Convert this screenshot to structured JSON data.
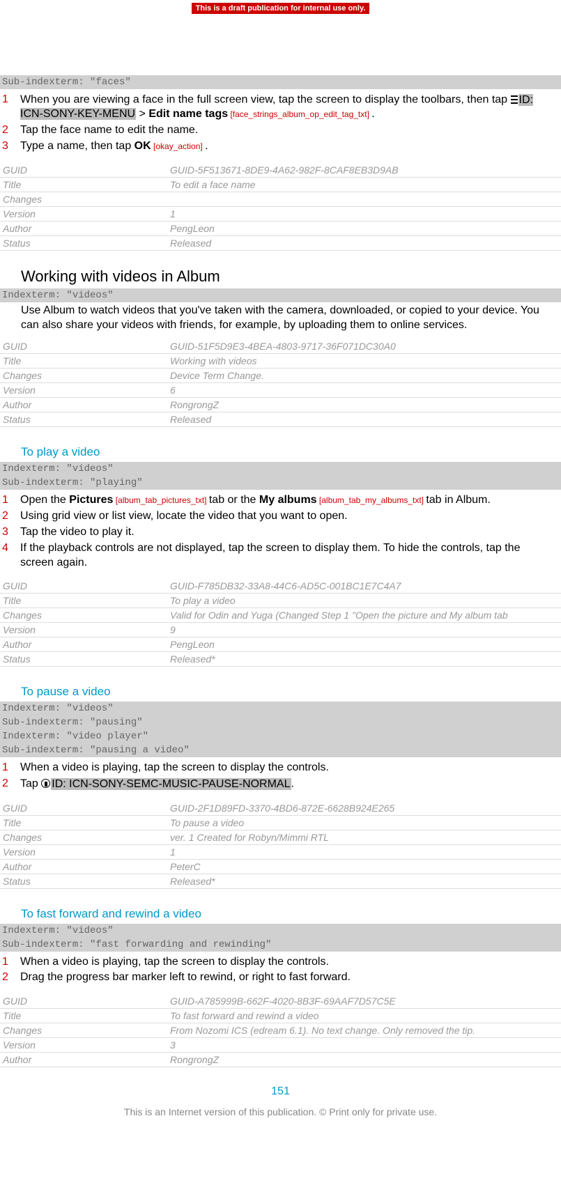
{
  "banner": "This is a draft publication for internal use only.",
  "block1": {
    "subindex": "Sub-indexterm: \"faces\"",
    "steps": [
      {
        "n": "1",
        "pre": "When you are viewing a face in the full screen view, tap the screen to display the toolbars, then tap ",
        "icnid": "ID: ICN-SONY-KEY-MENU",
        "mid": " > ",
        "bold": "Edit name tags",
        "sid": " [face_strings_album_op_edit_tag_txt] ",
        "post": "."
      },
      {
        "n": "2",
        "pre": "Tap the face name to edit the name."
      },
      {
        "n": "3",
        "pre": "Type a name, then tap ",
        "bold": "OK",
        "sid": " [okay_action] ",
        "post": "."
      }
    ],
    "meta": {
      "GUID": "GUID-5F513671-8DE9-4A62-982F-8CAF8EB3D9AB",
      "Title": "To edit a face name",
      "Changes": "",
      "Version": "1",
      "Author": "PengLeon",
      "Status": "Released"
    }
  },
  "block2": {
    "heading": "Working with videos in Album",
    "index": "Indexterm: \"videos\"",
    "para": "Use Album to watch videos that you've taken with the camera, downloaded, or copied to your device. You can also share your videos with friends, for example, by uploading them to online services.",
    "meta": {
      "GUID": "GUID-51F5D9E3-4BEA-4803-9717-36F071DC30A0",
      "Title": "Working with videos",
      "Changes": "Device Term Change.",
      "Version": "6",
      "Author": "RongrongZ",
      "Status": "Released"
    }
  },
  "block3": {
    "heading": "To play a video",
    "index1": "Indexterm: \"videos\"",
    "index2": "Sub-indexterm: \"playing\"",
    "s1": {
      "n": "1",
      "pre": "Open the ",
      "bold1": "Pictures",
      "sid1": " [album_tab_pictures_txt] ",
      "mid": "tab or the ",
      "bold2": "My albums",
      "sid2": " [album_tab_my_albums_txt] ",
      "post": "tab in Album."
    },
    "s2": {
      "n": "2",
      "pre": "Using grid view or list view, locate the video that you want to open."
    },
    "s3": {
      "n": "3",
      "pre": "Tap the video to play it."
    },
    "s4": {
      "n": "4",
      "pre": "If the playback controls are not displayed, tap the screen to display them. To hide the controls, tap the screen again."
    },
    "meta": {
      "GUID": "GUID-F785DB32-33A8-44C6-AD5C-001BC1E7C4A7",
      "Title": "To play a video",
      "Changes": "Valid for Odin and Yuga (Changed Step 1 \"Open the picture and My album tab",
      "Version": "9",
      "Author": "PengLeon",
      "Status": "Released*"
    }
  },
  "block4": {
    "heading": "To pause a video",
    "index1": "Indexterm: \"videos\"",
    "index2": "Sub-indexterm: \"pausing\"",
    "index3": "Indexterm: \"video player\"",
    "index4": "Sub-indexterm: \"pausing a video\"",
    "s1": {
      "n": "1",
      "pre": "When a video is playing, tap the screen to display the controls."
    },
    "s2": {
      "n": "2",
      "pre": "Tap ",
      "icnid": "ID: ICN-SONY-SEMC-MUSIC-PAUSE-NORMAL",
      "post": "."
    },
    "meta": {
      "GUID": "GUID-2F1D89FD-3370-4BD6-872E-6628B924E265",
      "Title": "To pause a video",
      "Changes": "ver. 1 Created for Robyn/Mimmi RTL",
      "Version": "1",
      "Author": "PeterC",
      "Status": "Released*"
    }
  },
  "block5": {
    "heading": "To fast forward and rewind a video",
    "index1": "Indexterm: \"videos\"",
    "index2": "Sub-indexterm: \"fast forwarding and rewinding\"",
    "s1": {
      "n": "1",
      "pre": "When a video is playing, tap the screen to display the controls."
    },
    "s2": {
      "n": "2",
      "pre": "Drag the progress bar marker left to rewind, or right to fast forward."
    },
    "meta": {
      "GUID": "GUID-A785999B-662F-4020-8B3F-69AAF7D57C5E",
      "Title": "To fast forward and rewind a video",
      "Changes": "From Nozomi ICS (edream 6.1). No text change. Only removed the tip.",
      "Version": "3",
      "Author": "RongrongZ"
    }
  },
  "pagenum": "151",
  "footerline": "This is an Internet version of this publication. © Print only for private use.",
  "metalabels": {
    "GUID": "GUID",
    "Title": "Title",
    "Changes": "Changes",
    "Version": "Version",
    "Author": "Author",
    "Status": "Status"
  }
}
